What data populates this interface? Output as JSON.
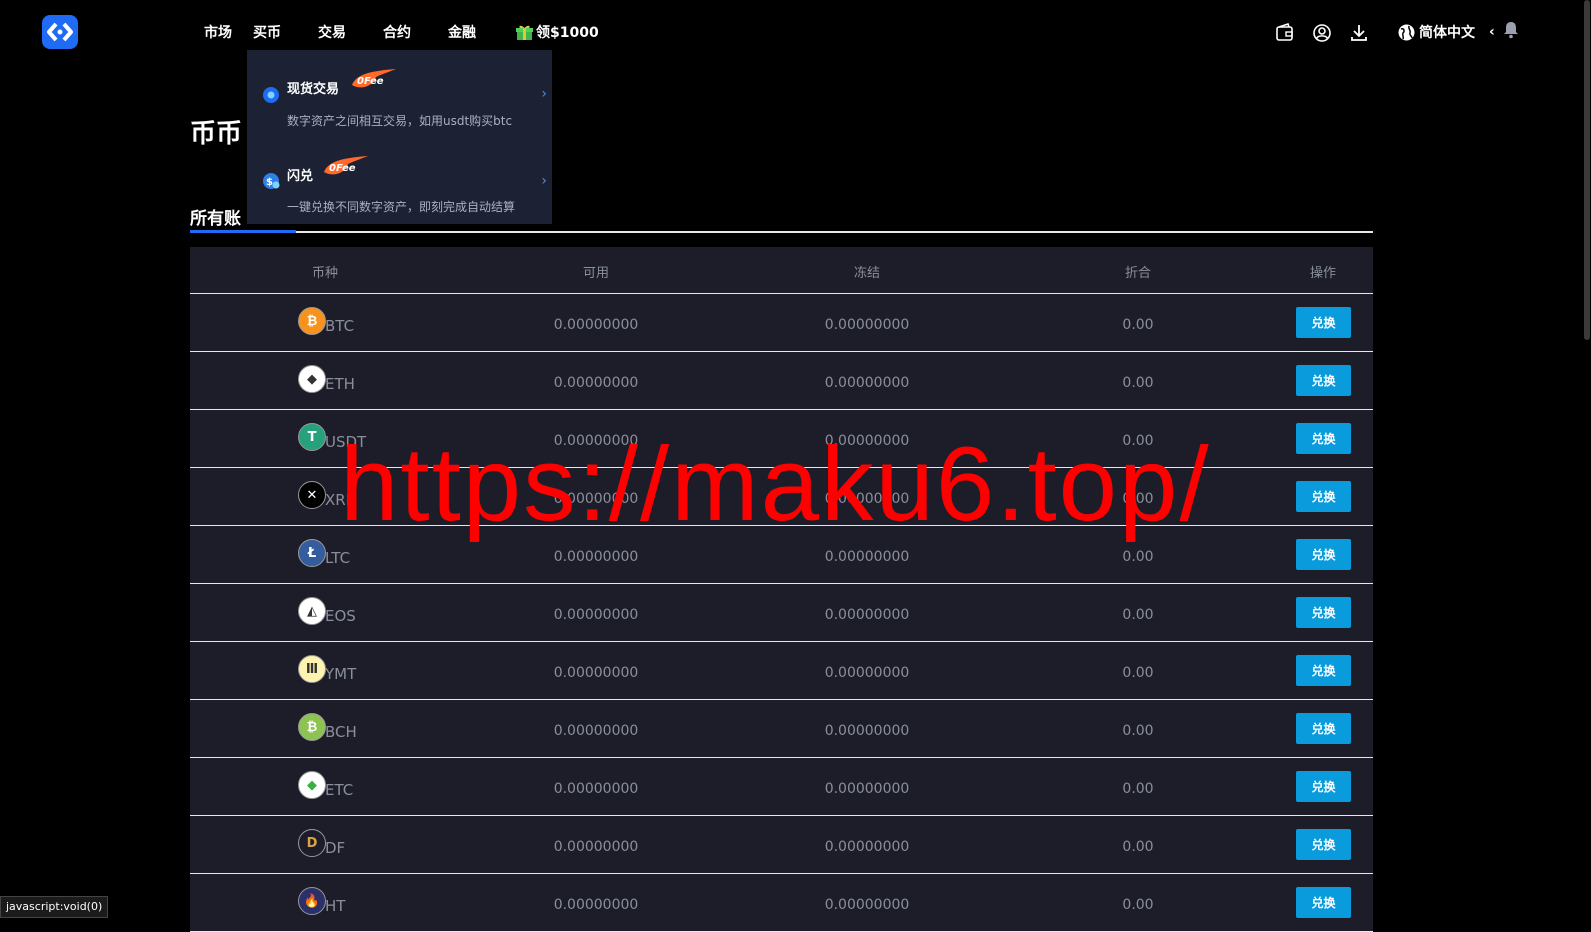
{
  "header": {
    "nav": [
      {
        "label": "市场"
      },
      {
        "label": "买币"
      },
      {
        "label": "交易"
      },
      {
        "label": "合约"
      },
      {
        "label": "金融"
      }
    ],
    "promo_label": "领$1000",
    "language_label": "简体中文"
  },
  "dropdown": {
    "items": [
      {
        "title": "现货交易",
        "badge": "0Fee",
        "desc": "数字资产之间相互交易，如用usdt购买btc"
      },
      {
        "title": "闪兑",
        "badge": "0Fee",
        "desc": "一键兑换不同数字资产，即刻完成自动结算"
      }
    ]
  },
  "page": {
    "title": "币币",
    "account_tab": "所有账"
  },
  "table": {
    "headers": [
      "币种",
      "可用",
      "冻结",
      "折合",
      "操作"
    ],
    "rows": [
      {
        "coin": "BTC",
        "available": "0.00000000",
        "frozen": "0.00000000",
        "equiv": "0.00",
        "action": "兑换"
      },
      {
        "coin": "ETH",
        "available": "0.00000000",
        "frozen": "0.00000000",
        "equiv": "0.00",
        "action": "兑换"
      },
      {
        "coin": "USDT",
        "available": "0.00000000",
        "frozen": "0.00000000",
        "equiv": "0.00",
        "action": "兑换"
      },
      {
        "coin": "XRP",
        "available": "0.00000000",
        "frozen": "0.00000000",
        "equiv": "0.00",
        "action": "兑换"
      },
      {
        "coin": "LTC",
        "available": "0.00000000",
        "frozen": "0.00000000",
        "equiv": "0.00",
        "action": "兑换"
      },
      {
        "coin": "EOS",
        "available": "0.00000000",
        "frozen": "0.00000000",
        "equiv": "0.00",
        "action": "兑换"
      },
      {
        "coin": "YMT",
        "available": "0.00000000",
        "frozen": "0.00000000",
        "equiv": "0.00",
        "action": "兑换"
      },
      {
        "coin": "BCH",
        "available": "0.00000000",
        "frozen": "0.00000000",
        "equiv": "0.00",
        "action": "兑换"
      },
      {
        "coin": "ETC",
        "available": "0.00000000",
        "frozen": "0.00000000",
        "equiv": "0.00",
        "action": "兑换"
      },
      {
        "coin": "DF",
        "available": "0.00000000",
        "frozen": "0.00000000",
        "equiv": "0.00",
        "action": "兑换"
      },
      {
        "coin": "HT",
        "available": "0.00000000",
        "frozen": "0.00000000",
        "equiv": "0.00",
        "action": "兑换"
      }
    ]
  },
  "icons": {
    "coins": [
      "btc-icon",
      "eth-icon",
      "usdt-icon",
      "xrp-icon",
      "ltc-icon",
      "eos-icon",
      "ymt-icon",
      "bch-icon",
      "etc-icon",
      "df-icon",
      "ht-icon"
    ],
    "colors": [
      "#f7931a",
      "#ffffff",
      "#26a17b",
      "#000000",
      "#345d9d",
      "#ffffff",
      "#fff3b0",
      "#8dc351",
      "#ffffff",
      "#1c1d29",
      "#2a3069"
    ]
  },
  "watermark": "https://maku6.top/",
  "status_bar": "javascript:void(0)",
  "colors": {
    "accent": "#1f6bf5",
    "button": "#0a9bdc",
    "dropdown_bg": "#1c2233",
    "table_bg": "#1c1d29",
    "watermark": "#ff0000"
  }
}
